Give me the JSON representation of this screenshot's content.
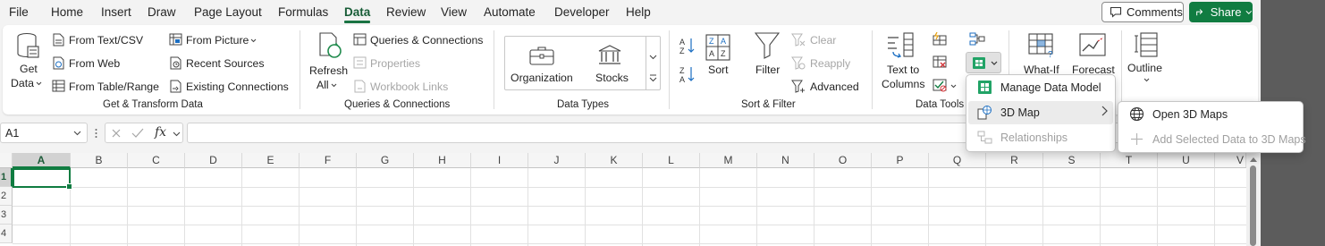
{
  "menu": {
    "tabs": [
      "File",
      "Home",
      "Insert",
      "Draw",
      "Page Layout",
      "Formulas",
      "Data",
      "Review",
      "View",
      "Automate",
      "Developer",
      "Help"
    ],
    "active_tab": "Data",
    "comments_label": "Comments",
    "share_label": "Share"
  },
  "ribbon": {
    "get_transform": {
      "get_data_line1": "Get",
      "get_data_line2": "Data",
      "from_text_csv": "From Text/CSV",
      "from_web": "From Web",
      "from_table_range": "From Table/Range",
      "from_picture": "From Picture",
      "recent_sources": "Recent Sources",
      "existing_connections": "Existing Connections",
      "group_label": "Get & Transform Data"
    },
    "queries": {
      "refresh_all_line1": "Refresh",
      "refresh_all_line2": "All",
      "queries_connections": "Queries & Connections",
      "properties": "Properties",
      "workbook_links": "Workbook Links",
      "group_label": "Queries & Connections"
    },
    "data_types": {
      "organization": "Organization",
      "stocks": "Stocks",
      "group_label": "Data Types"
    },
    "sort_filter": {
      "sort": "Sort",
      "filter": "Filter",
      "clear": "Clear",
      "reapply": "Reapply",
      "advanced": "Advanced",
      "group_label": "Sort & Filter"
    },
    "data_tools": {
      "text_to_columns_line1": "Text to",
      "text_to_columns_line2": "Columns",
      "group_label": "Data Tools"
    },
    "forecast": {
      "what_if": "What-If",
      "forecast": "Forecast"
    },
    "outline": {
      "outline": "Outline"
    }
  },
  "formula_bar": {
    "name_box": "A1",
    "fx": "fx",
    "formula": ""
  },
  "grid": {
    "columns": [
      "A",
      "B",
      "C",
      "D",
      "E",
      "F",
      "G",
      "H",
      "I",
      "J",
      "K",
      "L",
      "M",
      "N",
      "O",
      "P",
      "Q",
      "R",
      "S",
      "T",
      "U",
      "V"
    ],
    "rows": [
      "1",
      "2",
      "3",
      "4"
    ],
    "active_cell": "A1"
  },
  "data_model_menu": {
    "items": [
      {
        "label": "Manage Data Model",
        "enabled": true
      },
      {
        "label": "3D Map",
        "enabled": true
      },
      {
        "label": "Relationships",
        "enabled": false
      }
    ]
  },
  "map_submenu": {
    "items": [
      {
        "label": "Open 3D Maps",
        "enabled": true
      },
      {
        "label": "Add Selected Data to 3D Maps",
        "enabled": false
      }
    ]
  },
  "colors": {
    "accent": "#107c41",
    "active_tab_text": "#185c37",
    "disabled_text": "#a6a6a6"
  },
  "icons": [
    "comment-icon",
    "share-icon",
    "get-data-icon",
    "text-csv-icon",
    "web-icon",
    "table-range-icon",
    "picture-icon",
    "recent-sources-icon",
    "existing-connections-icon",
    "refresh-icon",
    "queries-icon",
    "properties-icon",
    "workbook-links-icon",
    "organization-icon",
    "stocks-icon",
    "sort-asc-icon",
    "sort-desc-icon",
    "sort-icon",
    "filter-icon",
    "clear-icon",
    "reapply-icon",
    "advanced-icon",
    "text-to-columns-icon",
    "flash-fill-icon",
    "remove-duplicates-icon",
    "data-validation-icon",
    "consolidate-icon",
    "relationships-icon",
    "data-model-icon",
    "what-if-icon",
    "forecast-icon",
    "outline-icon",
    "globe-icon",
    "plus-icon",
    "chevron-right-icon"
  ]
}
